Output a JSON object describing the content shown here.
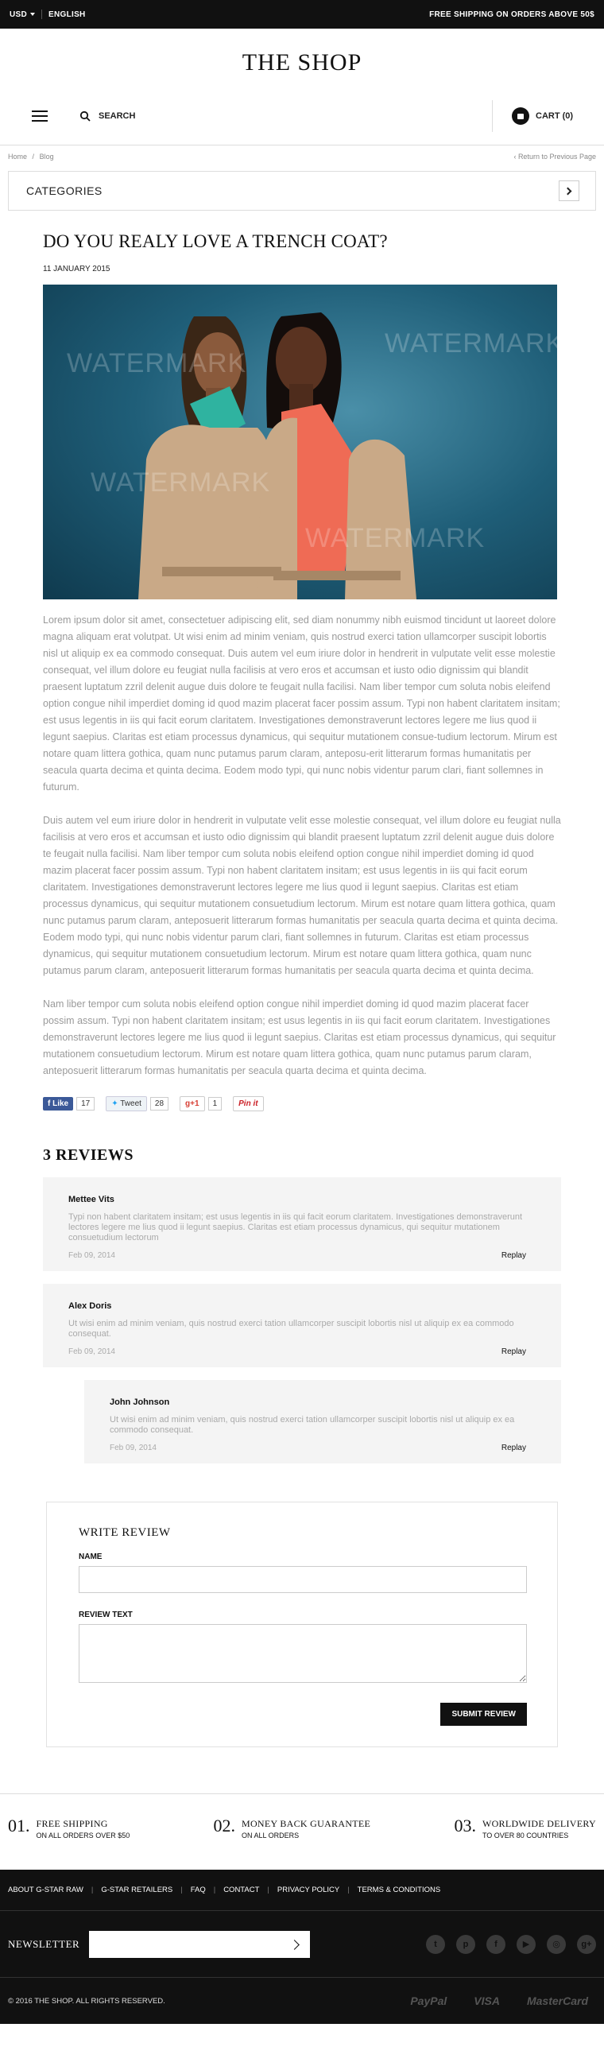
{
  "topbar": {
    "currency": "USD",
    "language": "ENGLISH",
    "promo": "FREE SHIPPING ON ORDERS ABOVE 50$"
  },
  "header": {
    "logo": "THE SHOP",
    "search_placeholder": "SEARCH",
    "cart_label": "CART (0)"
  },
  "breadcrumb": {
    "home": "Home",
    "separator": "/",
    "current": "Blog",
    "return": "Return to Previous Page"
  },
  "categories": {
    "label": "CATEGORIES"
  },
  "article": {
    "title": "DO YOU REALY LOVE A TRENCH COAT?",
    "date": "11 JANUARY 2015",
    "watermark": "WATERMARK",
    "paragraphs": [
      "Lorem ipsum dolor sit amet, consectetuer adipiscing elit, sed diam nonummy nibh euismod tincidunt ut laoreet dolore magna aliquam erat volutpat. Ut wisi enim ad minim veniam, quis nostrud exerci tation ullamcorper suscipit lobortis nisl ut aliquip ex ea commodo consequat. Duis autem vel eum iriure dolor in hendrerit in vulputate velit esse molestie consequat, vel illum dolore eu feugiat nulla facilisis at vero eros et accumsan et iusto odio dignissim qui blandit praesent luptatum zzril delenit augue duis dolore te feugait nulla facilisi. Nam liber tempor cum soluta nobis eleifend option congue nihil imperdiet doming id quod mazim placerat facer possim assum. Typi non habent claritatem insitam; est usus legentis in iis qui facit eorum claritatem. Investigationes demonstraverunt lectores legere me lius quod ii legunt saepius. Claritas est etiam processus dynamicus, qui sequitur mutationem consue-tudium lectorum. Mirum est notare quam littera gothica, quam nunc putamus parum claram, anteposu-erit litterarum formas humanitatis per seacula quarta decima et quinta decima. Eodem modo typi, qui nunc nobis videntur parum clari, fiant sollemnes in futurum.",
      "Duis autem vel eum iriure dolor in hendrerit in vulputate velit esse molestie consequat, vel illum dolore eu feugiat nulla facilisis at vero eros et accumsan et iusto odio dignissim qui blandit praesent luptatum zzril delenit augue duis dolore te feugait nulla facilisi. Nam liber tempor cum soluta nobis eleifend option congue nihil imperdiet doming id quod mazim placerat facer possim assum. Typi non habent claritatem insitam; est usus legentis in iis qui facit eorum claritatem. Investigationes demonstraverunt lectores legere me lius quod ii legunt saepius. Claritas est etiam processus dynamicus, qui sequitur mutationem consuetudium lectorum. Mirum est notare quam littera gothica, quam nunc putamus parum claram, anteposuerit litterarum formas humanitatis per seacula quarta decima et quinta decima. Eodem modo typi, qui nunc nobis videntur parum clari, fiant sollemnes in futurum. Claritas est etiam processus dynamicus, qui sequitur mutationem consuetudium lectorum. Mirum est notare quam littera gothica, quam nunc putamus parum claram, anteposuerit litterarum formas humanitatis per seacula quarta decima et quinta decima.",
      "Nam liber tempor cum soluta nobis eleifend option congue nihil imperdiet doming id quod mazim placerat facer possim assum. Typi non habent claritatem insitam; est usus legentis in iis qui facit eorum claritatem. Investigationes demonstraverunt lectores legere me lius quod ii legunt saepius. Claritas est etiam processus dynamicus, qui sequitur mutationem consuetudium lectorum. Mirum est notare quam littera gothica, quam nunc putamus parum claram, anteposuerit litterarum formas humanitatis per seacula quarta decima et quinta decima."
    ]
  },
  "social": {
    "like_label": "Like",
    "like_count": "17",
    "tweet_label": "Tweet",
    "tweet_count": "28",
    "gplus_label": "+1",
    "gplus_count": "1",
    "pin_label": "Pin it"
  },
  "reviews": {
    "title": "3 REVIEWS",
    "items": [
      {
        "name": "Mettee Vits",
        "text": "Typi non habent claritatem insitam; est usus legentis in iis qui facit eorum claritatem. Investigationes demonstraverunt lectores legere me lius quod ii legunt saepius. Claritas est etiam processus dynamicus, qui sequitur mutationem consuetudium lectorum",
        "date": "Feb 09, 2014",
        "reply": "Replay"
      },
      {
        "name": "Alex Doris",
        "text": "Ut wisi enim ad minim veniam, quis nostrud exerci tation ullamcorper suscipit lobortis nisl ut aliquip ex ea commodo consequat.",
        "date": "Feb 09, 2014",
        "reply": "Replay"
      },
      {
        "name": "John Johnson",
        "text": "Ut wisi enim ad minim veniam, quis nostrud exerci tation ullamcorper suscipit lobortis nisl ut aliquip ex ea commodo consequat.",
        "date": "Feb 09, 2014",
        "reply": "Replay"
      }
    ]
  },
  "write_review": {
    "title": "WRITE REVIEW",
    "name_label": "NAME",
    "text_label": "REVIEW TEXT",
    "submit": "SUBMIT REVIEW"
  },
  "features": [
    {
      "num": "01.",
      "title": "FREE SHIPPING",
      "sub": "ON ALL ORDERS OVER $50"
    },
    {
      "num": "02.",
      "title": "MONEY BACK GUARANTEE",
      "sub": "ON ALL ORDERS"
    },
    {
      "num": "03.",
      "title": "WORLDWIDE DELIVERY",
      "sub": "TO OVER 80 COUNTRIES"
    }
  ],
  "footer": {
    "links": [
      "ABOUT G-STAR RAW",
      "G-STAR RETAILERS",
      "FAQ",
      "CONTACT",
      "PRIVACY POLICY",
      "TERMS & CONDITIONS"
    ],
    "newsletter_label": "NEWSLETTER",
    "copyright": "© 2016 THE SHOP. ALL RIGHTS RESERVED.",
    "payments": [
      "PayPal",
      "VISA",
      "MasterCard"
    ]
  },
  "colors": {
    "topbar_bg": "#111111",
    "footer_bg": "#111111",
    "body_text": "#9a9a9a",
    "facebook": "#3b5998",
    "pinterest": "#cb2027"
  }
}
